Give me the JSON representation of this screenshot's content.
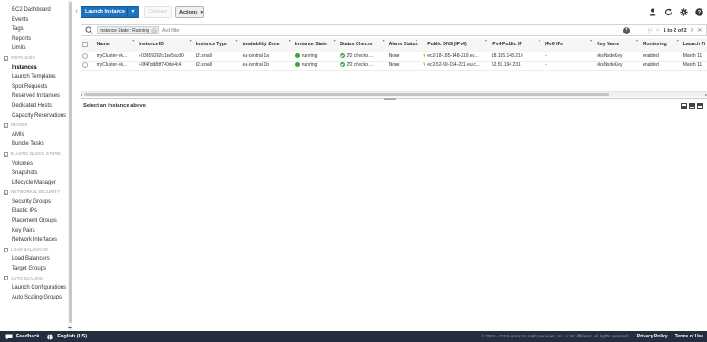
{
  "sidebar": {
    "items": [
      {
        "type": "item",
        "label": "EC2 Dashboard"
      },
      {
        "type": "item",
        "label": "Events"
      },
      {
        "type": "item",
        "label": "Tags"
      },
      {
        "type": "item",
        "label": "Reports"
      },
      {
        "type": "item",
        "label": "Limits"
      },
      {
        "type": "section",
        "label": "INSTANCES"
      },
      {
        "type": "item",
        "label": "Instances",
        "active": true
      },
      {
        "type": "item",
        "label": "Launch Templates"
      },
      {
        "type": "item",
        "label": "Spot Requests"
      },
      {
        "type": "item",
        "label": "Reserved Instances"
      },
      {
        "type": "item",
        "label": "Dedicated Hosts"
      },
      {
        "type": "item",
        "label": "Capacity Reservations"
      },
      {
        "type": "section",
        "label": "IMAGES"
      },
      {
        "type": "item",
        "label": "AMIs"
      },
      {
        "type": "item",
        "label": "Bundle Tasks"
      },
      {
        "type": "section",
        "label": "ELASTIC BLOCK STORE"
      },
      {
        "type": "item",
        "label": "Volumes"
      },
      {
        "type": "item",
        "label": "Snapshots"
      },
      {
        "type": "item",
        "label": "Lifecycle Manager"
      },
      {
        "type": "section",
        "label": "NETWORK & SECURITY"
      },
      {
        "type": "item",
        "label": "Security Groups"
      },
      {
        "type": "item",
        "label": "Elastic IPs"
      },
      {
        "type": "item",
        "label": "Placement Groups"
      },
      {
        "type": "item",
        "label": "Key Pairs"
      },
      {
        "type": "item",
        "label": "Network Interfaces"
      },
      {
        "type": "section",
        "label": "LOAD BALANCING"
      },
      {
        "type": "item",
        "label": "Load Balancers"
      },
      {
        "type": "item",
        "label": "Target Groups"
      },
      {
        "type": "section",
        "label": "AUTO SCALING"
      },
      {
        "type": "item",
        "label": "Launch Configurations"
      },
      {
        "type": "item",
        "label": "Auto Scaling Groups"
      }
    ]
  },
  "toolbar": {
    "launch_label": "Launch Instance",
    "connect_label": "Connect",
    "actions_label": "Actions"
  },
  "filter": {
    "token_label": "Instance State : Running",
    "placeholder": "Add filter",
    "pager_text": "1 to 2 of 2"
  },
  "table": {
    "columns": [
      "Name",
      "Instance ID",
      "Instance Type",
      "Availability Zone",
      "Instance State",
      "Status Checks",
      "Alarm Status",
      "Public DNS (IPv4)",
      "IPv4 Public IP",
      "IPv6 IPs",
      "Key Name",
      "Monitoring",
      "Launch Ti"
    ],
    "rows": [
      [
        "myCluster-ek...",
        "i-03659202c1ae5acd0",
        "t2.small",
        "eu-central-1a",
        "running",
        "2/2 checks ...",
        "None",
        "ec2-18-185-148-219.eu...",
        "18.185.148.219",
        "-",
        "eksNodeKey",
        "enabled",
        "March 11,"
      ],
      [
        "myCluster-ek...",
        "i-0f47dd8df740de4c4",
        "t2.small",
        "eu-central-1b",
        "running",
        "2/2 checks ...",
        "None",
        "ec2-52-59-194-231.eu-c...",
        "52.59.194.231",
        "-",
        "eksNodeKey",
        "enabled",
        "March 11,"
      ]
    ]
  },
  "details": {
    "placeholder": "Select an instance above"
  },
  "footer": {
    "feedback_label": "Feedback",
    "language_label": "English (US)",
    "copyright": "© 2008 - 2019, Amazon Web Services, Inc. or its affiliates. All rights reserved.",
    "privacy_label": "Privacy Policy",
    "terms_label": "Terms of Use"
  },
  "colors": {
    "primary_button": "#1e73be",
    "running_green": "#3aa53a",
    "footer_bg": "#232f3e"
  },
  "icons": [
    "user-icon",
    "refresh-icon",
    "settings-icon",
    "help-icon",
    "search-icon",
    "alarm-bell-icon"
  ]
}
